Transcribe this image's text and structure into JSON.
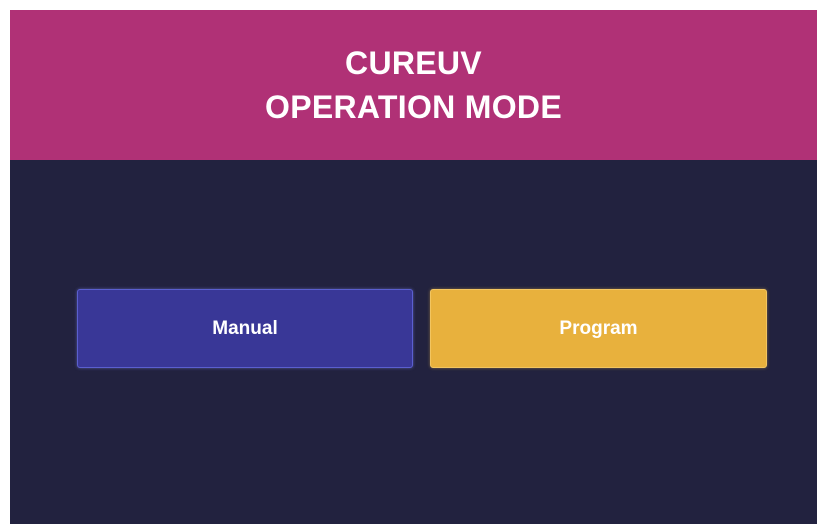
{
  "header": {
    "title_line1": "CUREUV",
    "title_line2": "OPERATION MODE"
  },
  "modes": {
    "manual_label": "Manual",
    "program_label": "Program"
  },
  "colors": {
    "header_background": "#b03176",
    "screen_background": "#22223f",
    "manual_button": "#393797",
    "program_button": "#e8b13d",
    "text": "#ffffff"
  }
}
